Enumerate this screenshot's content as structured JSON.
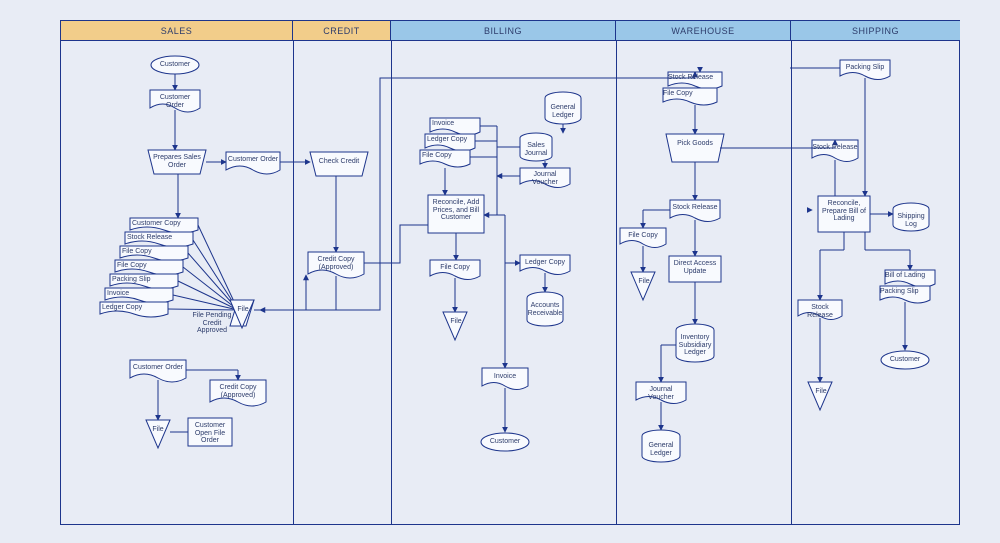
{
  "lanes": {
    "sales": "SALES",
    "credit": "CREDIT",
    "billing": "BILLING",
    "warehouse": "WAREHOUSE",
    "shipping": "SHIPPING"
  },
  "sales": {
    "customer": "Customer",
    "customer_order": "Customer Order",
    "prepares": "Prepares Sales Order",
    "customer_order2": "Customer Order",
    "copies": {
      "customer_copy": "Customer Copy",
      "stock_release": "Stock Release",
      "file_copy1": "File Copy",
      "file_copy2": "File Copy",
      "packing_slip": "Packing Slip",
      "invoice": "Invoice",
      "ledger_copy": "Ledger Copy"
    },
    "pending_label": "File Pending Credit Approved",
    "file": "File",
    "customer_order3": "Customer Order",
    "credit_copy_appr": "Credit Copy (Approved)",
    "file2": "File",
    "open_file": "Customer Open File Order"
  },
  "credit": {
    "check_credit": "Check Credit",
    "credit_copy": "Credit Copy (Approved)"
  },
  "billing": {
    "general_ledger": "General Ledger",
    "invoice": "Invoice",
    "ledger_copy": "Ledger Copy",
    "file_copy": "File Copy",
    "sales_journal": "Sales Journal",
    "journal_voucher": "Journal Voucher",
    "reconcile": "Reconcile, Add Prices, and Bill Customer",
    "file_copy2": "File Copy",
    "ledger_copy2": "Ledger Copy",
    "accounts_recv": "Accounts Receivable",
    "file": "File",
    "invoice2": "Invoice",
    "customer": "Customer"
  },
  "warehouse": {
    "stock_release": "Stock Release",
    "file_copy_hdr": "File Copy",
    "pick_goods": "Pick Goods",
    "stock_release2": "Stock Release",
    "file_copy": "File Copy",
    "file": "File",
    "direct_access": "Direct Access Update",
    "inventory": "Inventory Subsidiary Ledger",
    "journal_voucher": "Journal Voucher",
    "general_ledger": "General Ledger"
  },
  "shipping": {
    "packing_slip": "Packing Slip",
    "stock_release": "Stock Release",
    "reconcile": "Reconcile, Prepare Bill of Lading",
    "shipping_log": "Shipping Log",
    "bill_of_lading": "Bill of Lading",
    "packing_slip2": "Packing Slip",
    "stock_release2": "Stock Release",
    "file": "File",
    "customer": "Customer"
  }
}
